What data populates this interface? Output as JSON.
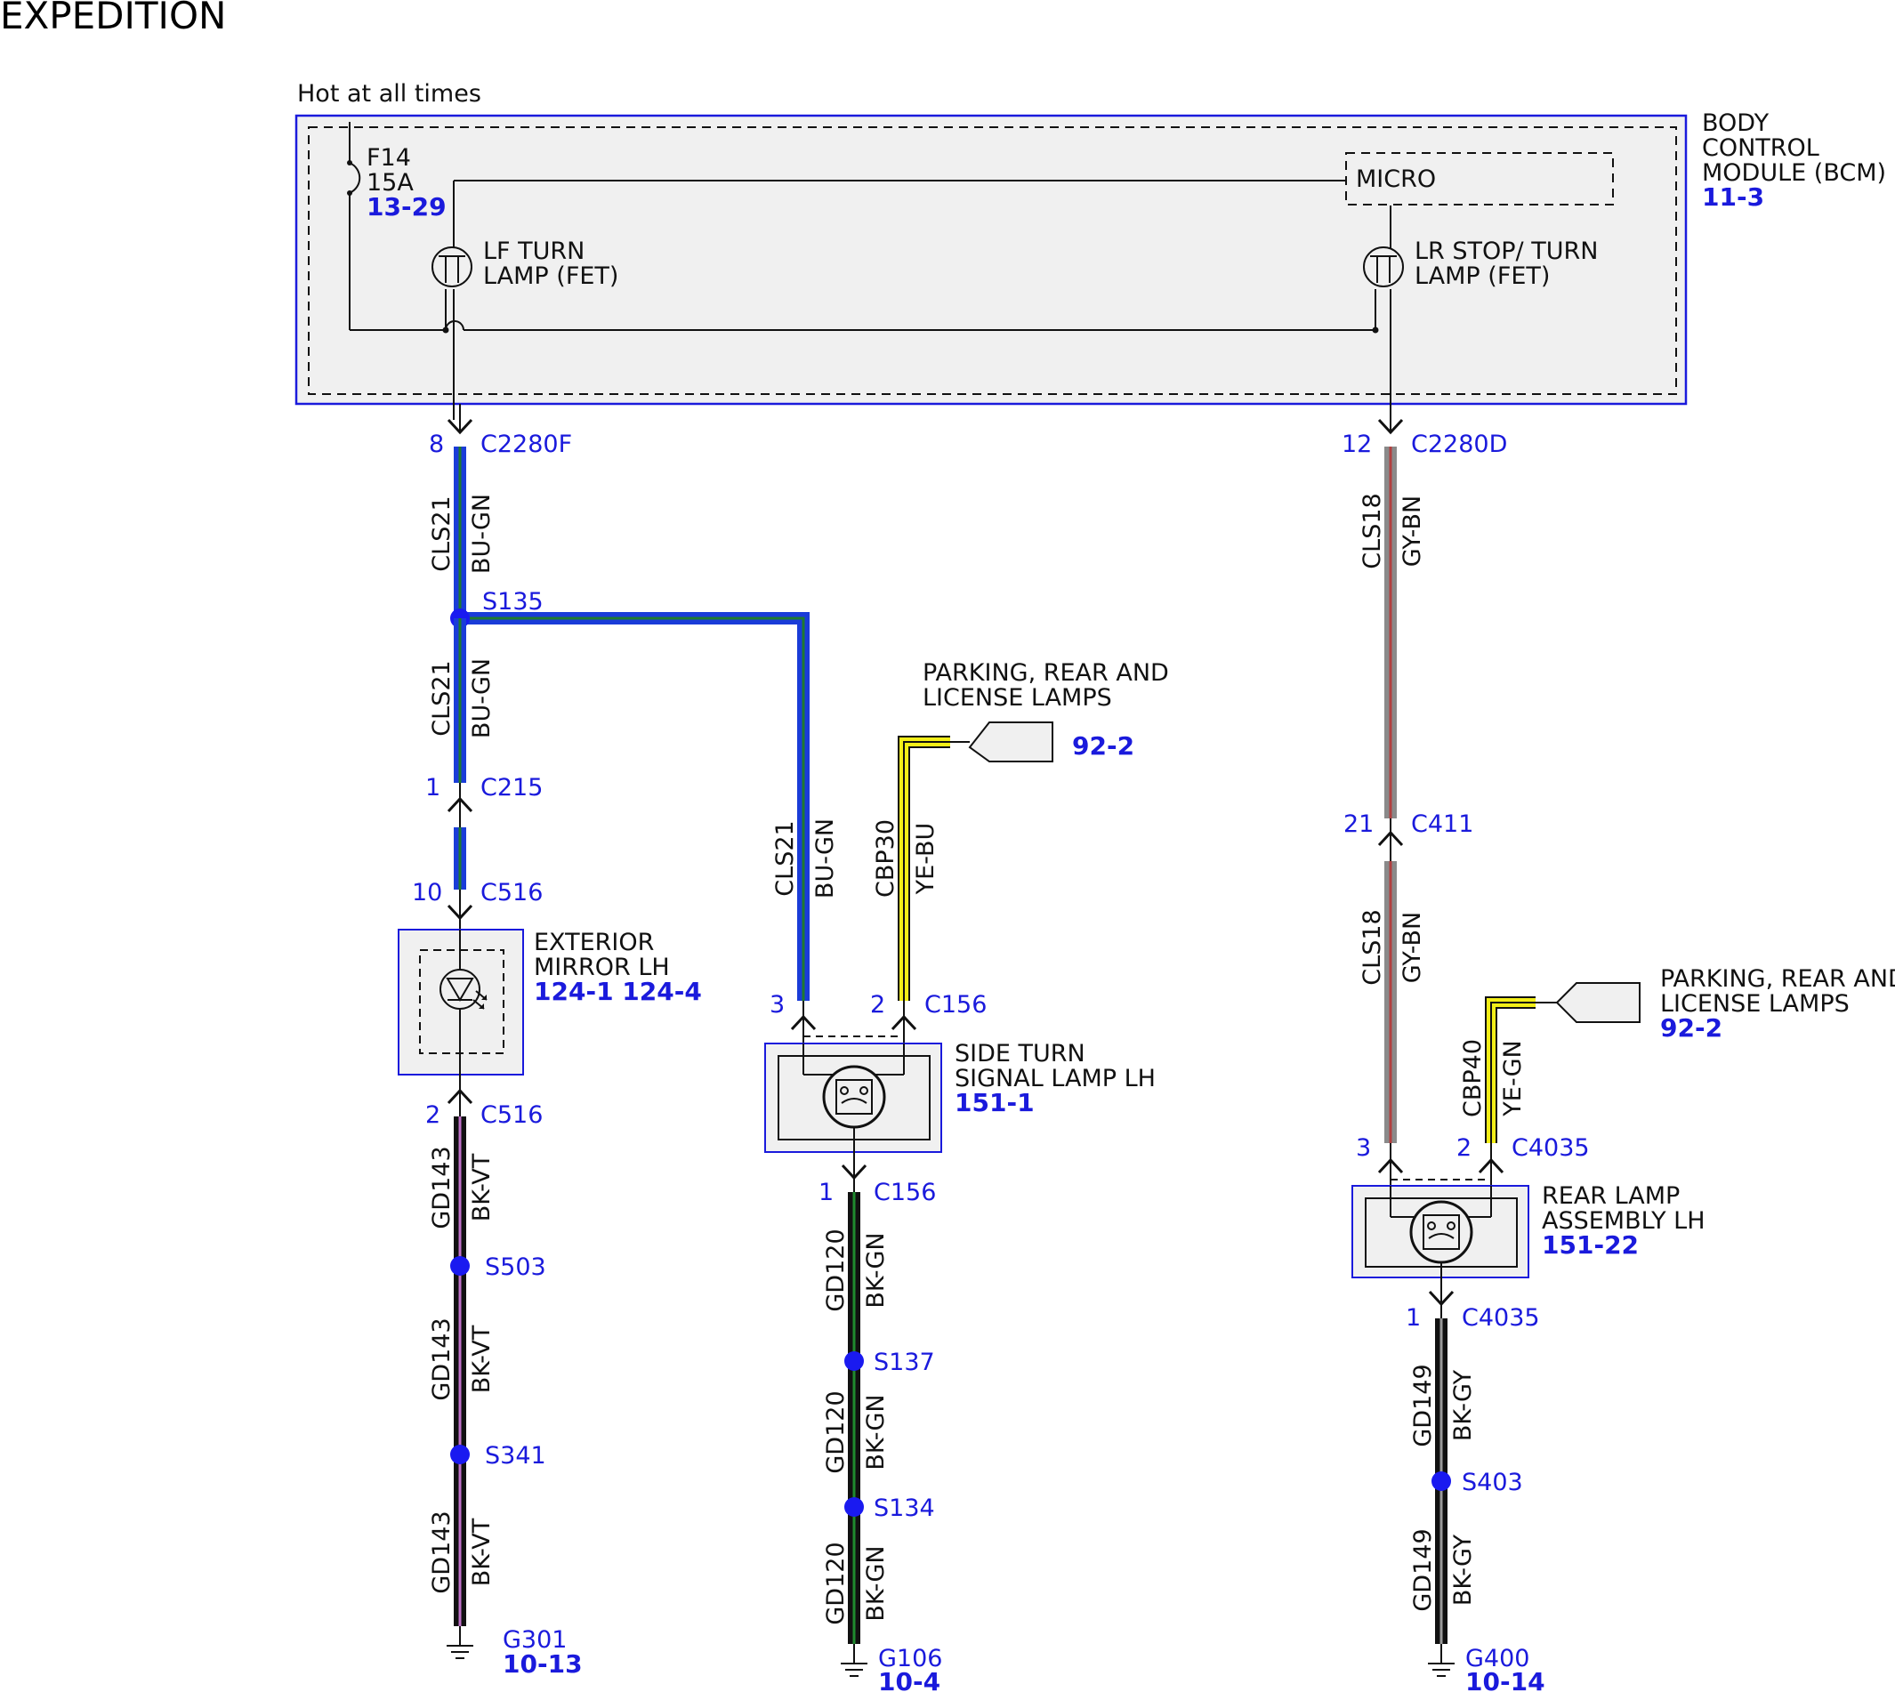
{
  "title": "EXPEDITION",
  "hot_label": "Hot at all times",
  "bcm": {
    "name_1": "BODY",
    "name_2": "CONTROL",
    "name_3": "MODULE (BCM)",
    "ref": "11-3"
  },
  "fuse": {
    "name": "F14",
    "rating": "15A",
    "ref": "13-29"
  },
  "micro": "MICRO",
  "lf_fet": {
    "line1": "LF TURN",
    "line2": "LAMP (FET)"
  },
  "lr_fet": {
    "line1": "LR STOP/ TURN",
    "line2": "LAMP (FET)"
  },
  "connectors": {
    "c2280f": {
      "pin": "8",
      "name": "C2280F"
    },
    "c2280d": {
      "pin": "12",
      "name": "C2280D"
    },
    "c215": {
      "pin": "1",
      "name": "C215"
    },
    "c516a": {
      "pin": "10",
      "name": "C516"
    },
    "c516b": {
      "pin": "2",
      "name": "C516"
    },
    "c411": {
      "pin": "21",
      "name": "C411"
    },
    "c156a": {
      "pin3": "3",
      "pin2": "2",
      "name": "C156"
    },
    "c156b": {
      "pin": "1",
      "name": "C156"
    },
    "c4035a": {
      "pin3": "3",
      "pin2": "2",
      "name": "C4035"
    },
    "c4035b": {
      "pin": "1",
      "name": "C4035"
    }
  },
  "splices": {
    "s135": "S135",
    "s503": "S503",
    "s341": "S341",
    "s137": "S137",
    "s134": "S134",
    "s403": "S403"
  },
  "wires": {
    "cls21": {
      "circuit": "CLS21",
      "color": "BU-GN"
    },
    "cls18": {
      "circuit": "CLS18",
      "color": "GY-BN"
    },
    "cbp30": {
      "circuit": "CBP30",
      "color": "YE-BU"
    },
    "cbp40": {
      "circuit": "CBP40",
      "color": "YE-GN"
    },
    "gd143": {
      "circuit": "GD143",
      "color": "BK-VT"
    },
    "gd120": {
      "circuit": "GD120",
      "color": "BK-GN"
    },
    "gd149": {
      "circuit": "GD149",
      "color": "BK-GY"
    }
  },
  "mirror": {
    "line1": "EXTERIOR",
    "line2": "MIRROR LH",
    "ref": "124-1 124-4"
  },
  "side_lamp": {
    "line1": "SIDE TURN",
    "line2": "SIGNAL LAMP LH",
    "ref": "151-1"
  },
  "rear_lamp": {
    "line1": "REAR LAMP",
    "line2": "ASSEMBLY LH",
    "ref": "151-22"
  },
  "parking_1": {
    "line1": "PARKING, REAR AND",
    "line2": "LICENSE LAMPS",
    "ref": "92-2"
  },
  "parking_2": {
    "line1": "PARKING, REAR AND",
    "line2": "LICENSE LAMPS",
    "ref": "92-2"
  },
  "grounds": {
    "g301": {
      "name": "G301",
      "ref": "10-13"
    },
    "g106": {
      "name": "G106",
      "ref": "10-4"
    },
    "g400": {
      "name": "G400",
      "ref": "10-14"
    }
  },
  "colors": {
    "blue_wire": "#1a3cd8",
    "blue_wire_stripe": "#1f7a2e",
    "gray_wire": "#8a8a8a",
    "gray_wire_stripe": "#b04040",
    "yellow_wire": "#f2ee18",
    "black_wire": "#111111",
    "violet_stripe": "#c070c8",
    "green_stripe": "#1f8a2e",
    "gray_stripe": "#9a9a9a",
    "label_blue": "#1a1adc",
    "component_fill": "#f0f0f0"
  }
}
